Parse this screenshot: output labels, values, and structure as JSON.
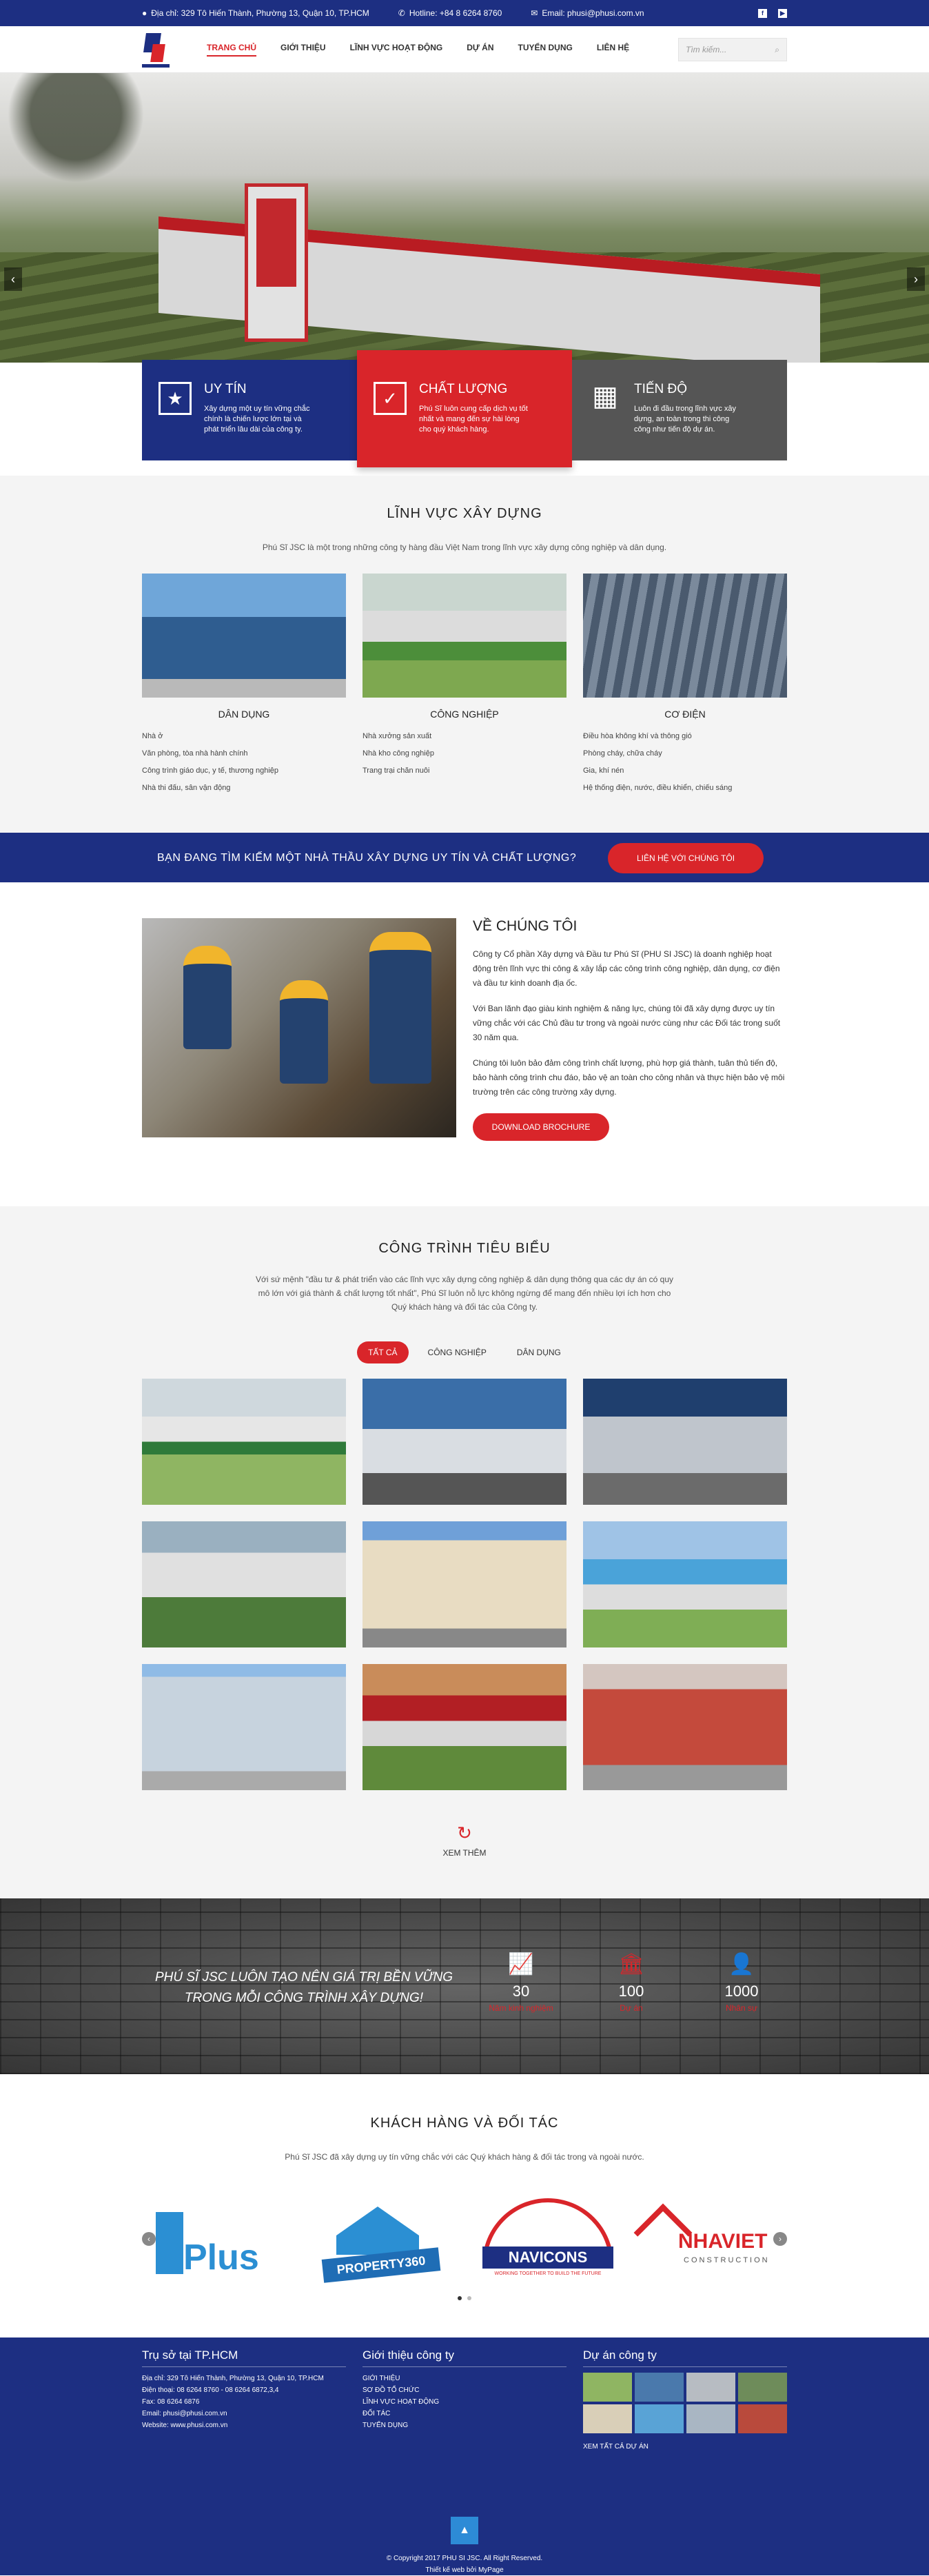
{
  "topbar": {
    "address": "Địa chỉ: 329 Tô Hiến Thành, Phường 13, Quận 10, TP.HCM",
    "hotline": "Hotline: +84 8 6264 8760",
    "email": "Email: phusi@phusi.com.vn"
  },
  "nav": {
    "items": [
      "TRANG CHỦ",
      "GIỚI THIỆU",
      "LĨNH VỰC HOẠT ĐỘNG",
      "DỰ ÁN",
      "TUYỂN DỤNG",
      "LIÊN HỆ"
    ],
    "search_placeholder": "Tìm kiếm..."
  },
  "hero": {
    "prev": "‹",
    "next": "›"
  },
  "features": [
    {
      "icon": "star-icon",
      "title": "UY TÍN",
      "text": "Xây dựng một uy tín vững chắc chính là chiến lược lớn tại và phát triển lâu dài của công ty."
    },
    {
      "icon": "checkbox-icon",
      "title": "CHẤT LƯỢNG",
      "text": "Phú Sĩ luôn cung cấp dịch vụ tốt nhất và mang đến sự hài lòng cho quý khách hàng."
    },
    {
      "icon": "calendar-icon",
      "title": "TIẾN ĐỘ",
      "text": "Luôn đi đầu trong lĩnh vực xây dựng, an toàn trong thi công công như tiến độ dự án."
    }
  ],
  "linhvuc": {
    "title": "LĨNH VỰC XÂY DỰNG",
    "desc": "Phú Sĩ JSC là một trong những công ty hàng đầu Việt Nam trong lĩnh vực xây dựng công nghiệp và dân dụng.",
    "cols": [
      {
        "title": "DÂN DỤNG",
        "items": [
          "Nhà ở",
          "Văn phòng, tòa nhà hành chính",
          "Công trình giáo dục, y tế, thương nghiệp",
          "Nhà thi đấu, sân vận động"
        ]
      },
      {
        "title": "CÔNG NGHIỆP",
        "items": [
          "Nhà xưởng sản xuất",
          "Nhà kho công nghiệp",
          "Trang trại chăn nuôi"
        ]
      },
      {
        "title": "CƠ ĐIỆN",
        "items": [
          "Điều hòa không khí và thông gió",
          "Phòng cháy, chữa cháy",
          "Gia, khí nén",
          "Hệ thống điện, nước, điều khiển, chiếu sáng"
        ]
      }
    ]
  },
  "banner": {
    "text": "BẠN ĐANG TÌM KIẾM MỘT NHÀ THẦU XÂY DỰNG UY TÍN VÀ CHẤT LƯỢNG?",
    "button": "LIÊN HỆ VỚI CHÚNG TÔI"
  },
  "about": {
    "title": "VỀ CHÚNG TÔI",
    "p1": "Công ty Cổ phần Xây dựng và Đầu tư Phú Sĩ (PHU SI JSC) là doanh nghiệp hoạt động trên lĩnh vực thi công & xây lắp các công trình công nghiệp, dân dụng, cơ điện và đầu tư kinh doanh địa ốc.",
    "p2": "Với Ban lãnh đạo giàu kinh nghiệm & năng lực, chúng tôi đã xây dựng được uy tín vững chắc với các Chủ đầu tư trong và ngoài nước cùng như các Đối tác trong suốt 30 năm qua.",
    "p3": "Chúng tôi luôn bảo đảm công trình chất lượng, phù hợp giá thành, tuân thủ tiến độ, bảo hành công trình chu đáo, bảo vệ an toàn cho công nhân và thực hiện bảo vệ môi trường trên các công trường xây dựng.",
    "button": "DOWNLOAD BROCHURE"
  },
  "projects": {
    "title": "CÔNG TRÌNH TIÊU BIỂU",
    "desc": "Với sứ mệnh \"đầu tư & phát triển vào các lĩnh vực xây dựng công nghiệp & dân dụng thông qua các dự án có quy mô lớn với giá thành & chất lượng tốt nhất\", Phú Sĩ luôn nỗ lực không ngừng để mang đến nhiều lợi ích hơn cho Quý khách hàng và đối tác của Công ty.",
    "tabs": [
      "TẤT CẢ",
      "CÔNG NGHIỆP",
      "DÂN DỤNG"
    ],
    "more": "XEM THÊM"
  },
  "stats": {
    "slogan": "PHÚ SĨ JSC LUÔN TẠO NÊN GIÁ TRỊ BỀN VỮNG TRONG MỖI CÔNG TRÌNH XÂY DỰNG!",
    "items": [
      {
        "icon": "chart-icon",
        "num": "30",
        "label": "Năm kinh nghiệm"
      },
      {
        "icon": "building-icon",
        "num": "100",
        "label": "Dự án"
      },
      {
        "icon": "person-icon",
        "num": "1000",
        "label": "Nhân sự"
      }
    ]
  },
  "partners": {
    "title": "KHÁCH HÀNG VÀ ĐỐI TÁC",
    "desc": "Phú Sĩ JSC đã xây dựng uy tín vững chắc với các Quý khách hàng & đối tác trong và ngoài nước.",
    "logos": [
      "Plus",
      "PROPERTY360",
      "NAVICONS",
      "NHAVIET"
    ],
    "navicons_tag": "WORKING TOGETHER TO BUILD THE FUTURE",
    "nhaviet_tag": "CONSTRUCTION"
  },
  "footer": {
    "col1_title": "Trụ sở tại TP.HCM",
    "col1_items": [
      "Địa chỉ: 329 Tô Hiến Thành, Phường 13, Quận 10, TP.HCM",
      "Điện thoại: 08 6264 8760 - 08 6264 6872,3,4",
      "Fax: 08 6264 6876",
      "Email: phusi@phusi.com.vn",
      "Website: www.phusi.com.vn"
    ],
    "col2_title": "Giới thiệu công ty",
    "col2_items": [
      "GIỚI THIỆU",
      "SƠ ĐỒ TỔ CHỨC",
      "LĨNH VỰC HOẠT ĐỘNG",
      "ĐỐI TÁC",
      "TUYỂN DỤNG"
    ],
    "col3_title": "Dự án công ty",
    "col3_more": "XEM TẤT CẢ DỰ ÁN",
    "copyright": "© Copyright 2017 PHU SI JSC. All Right Reserved.",
    "design": "Thiết kế web bởi MyPage"
  }
}
